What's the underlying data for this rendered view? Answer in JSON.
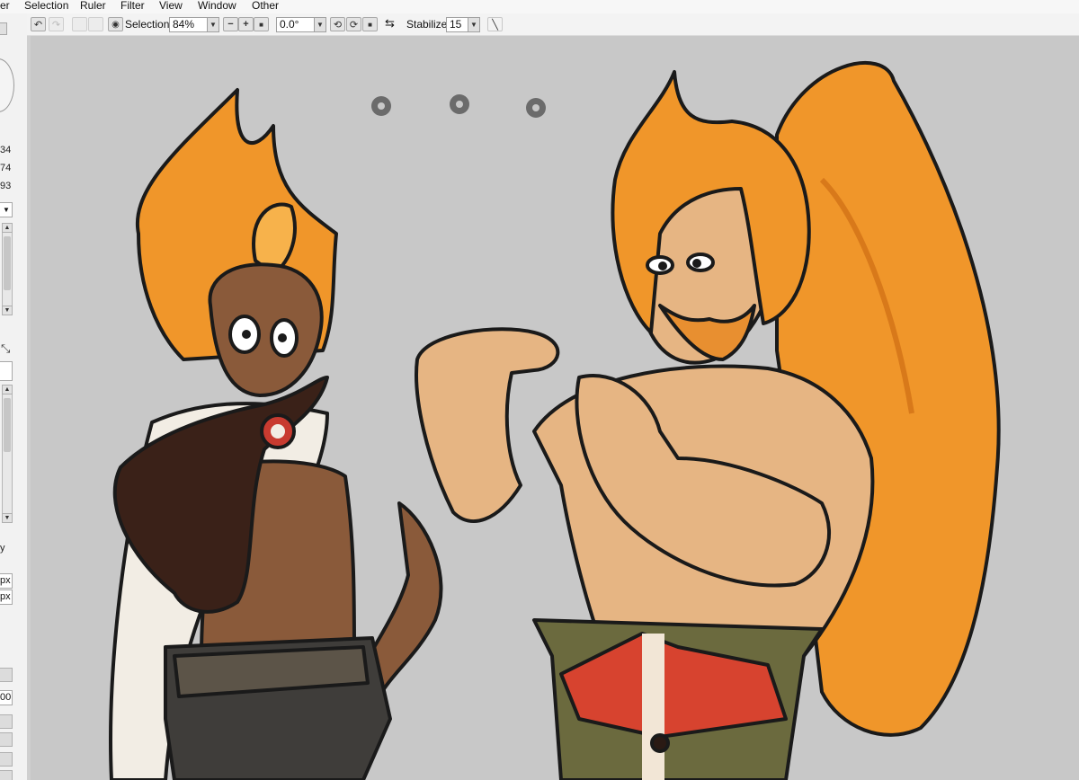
{
  "menubar": {
    "items": [
      "er",
      "Selection",
      "Ruler",
      "Filter",
      "View",
      "Window",
      "Other"
    ]
  },
  "toolbar": {
    "selection_label": "Selection",
    "zoom_value": "84%",
    "rotation_value": "0.0°",
    "stabilizer_label": "Stabilizer",
    "stabilizer_value": "15"
  },
  "left_panel": {
    "values": [
      "34",
      "74",
      "93"
    ],
    "short_label": "y",
    "px_field_1": "px",
    "px_field_2": "px",
    "bottom_field": "00"
  },
  "icons": {
    "undo": "undo-icon",
    "redo": "redo-icon",
    "visibility": "eye-icon",
    "flip": "flip-horizontal-icon",
    "line": "line-tool-icon"
  },
  "colors": {
    "canvas_bg": "#c8c8c8",
    "hair_orange": "#f0962a",
    "skin_dark": "#8a5a3a",
    "skin_light": "#e6b583",
    "cape_white": "#f2ede4"
  }
}
